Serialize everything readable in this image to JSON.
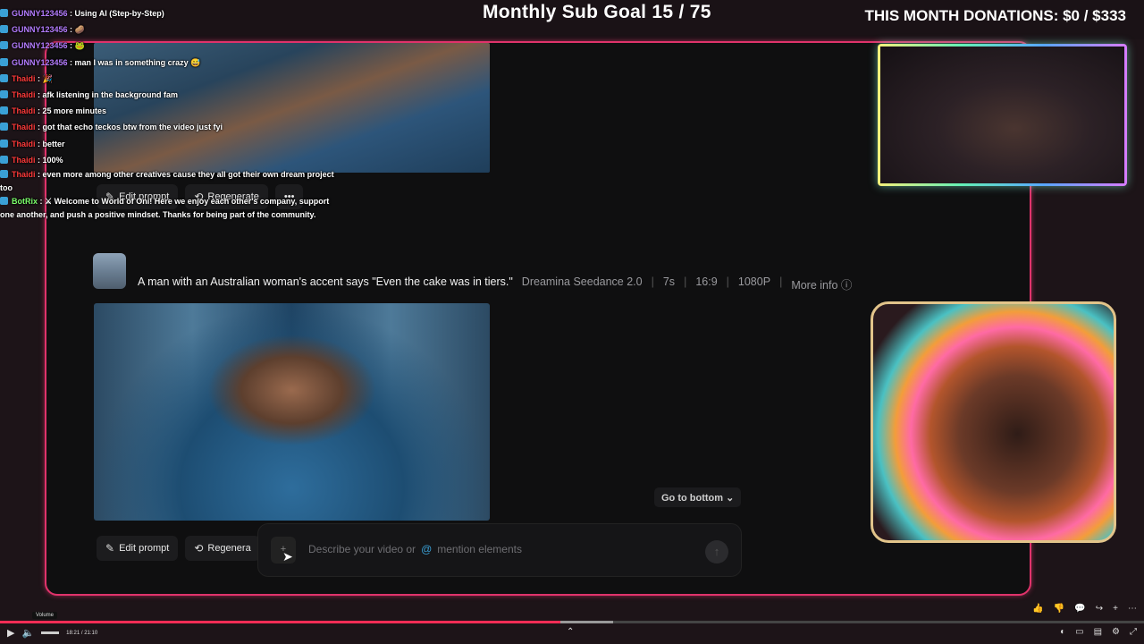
{
  "overlay": {
    "sub_goal": "Monthly Sub Goal 15 / 75",
    "donations": "THIS MONTH DONATIONS: $0 / $333"
  },
  "chat": {
    "messages": [
      {
        "user": "GUNNY123456",
        "text": "Using AI (Step-by-Step)",
        "color": "#b47cff"
      },
      {
        "user": "GUNNY123456",
        "text": "🥔",
        "color": "#b47cff"
      },
      {
        "user": "GUNNY123456",
        "text": "🐸",
        "color": "#b47cff"
      },
      {
        "user": "GUNNY123456",
        "text": "man I was in something crazy 😅",
        "color": "#b47cff"
      },
      {
        "user": "Thaidi",
        "text": "🎉",
        "color": "#ff3a3a"
      },
      {
        "user": "Thaidi",
        "text": "afk listening in the background fam",
        "color": "#ff3a3a"
      },
      {
        "user": "Thaidi",
        "text": "25 more minutes",
        "color": "#ff3a3a"
      },
      {
        "user": "Thaidi",
        "text": "got that echo teckos btw from the video just fyi",
        "color": "#ff3a3a"
      },
      {
        "user": "Thaidi",
        "text": "better",
        "color": "#ff3a3a"
      },
      {
        "user": "Thaidi",
        "text": "100%",
        "color": "#ff3a3a"
      },
      {
        "user": "Thaidi",
        "text": "even more among other creatives cause they all got their own dream project too",
        "color": "#ff3a3a"
      },
      {
        "user": "BotRix",
        "text": "⚔ Welcome to World of Oni! Here we enjoy each other's company, support one another, and push a positive mindset. Thanks for being part of the community.",
        "color": "#7cff6b"
      }
    ]
  },
  "app": {
    "actions_top": {
      "edit": "Edit prompt",
      "regenerate": "Regenerate",
      "more": "•••"
    },
    "prompt": {
      "text": "A man with an Australian woman's accent says \"Even the cake was in tiers.\"",
      "model": "Dreamina Seedance 2.0",
      "duration": "7s",
      "ratio": "16:9",
      "resolution": "1080P",
      "more_info": "More info ⓘ"
    },
    "actions_bottom": {
      "edit": "Edit prompt",
      "regenerate": "Regenera"
    },
    "go_to_bottom": "Go to bottom ⌄",
    "input": {
      "placeholder": "Describe your video or",
      "mention": "mention elements",
      "at": "@"
    }
  },
  "player": {
    "time": "18:21 / 21:10",
    "volume_tip": "Volume",
    "progress": 0.49
  }
}
